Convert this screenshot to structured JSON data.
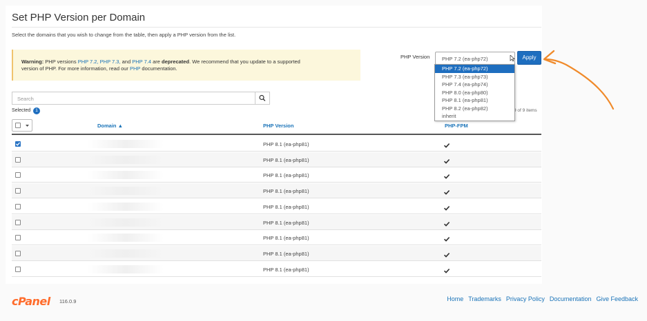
{
  "page": {
    "title": "Set PHP Version per Domain",
    "subtitle": "Select the domains that you wish to change from the table, then apply a PHP version from the list."
  },
  "warning": {
    "label": "Warning:",
    "text_1": " PHP versions ",
    "versions": "PHP 7.2, PHP 7.3,",
    "text_and": " and ",
    "version_last": "PHP 7.4",
    "text_are": " are ",
    "deprecated": "deprecated",
    "text_2": ". We recommend that you update to a supported",
    "text_3": "version of PHP. For more information, read our ",
    "link": "PHP",
    "text_4": " documentation."
  },
  "php_selector": {
    "label": "PHP Version",
    "selected": "PHP 7.2 (ea-php72)",
    "apply_label": "Apply",
    "options": [
      "PHP 7.2 (ea-php72)",
      "PHP 7.3 (ea-php73)",
      "PHP 7.4 (ea-php74)",
      "PHP 8.0 (ea-php80)",
      "PHP 8.1 (ea-php81)",
      "PHP 8.2 (ea-php82)",
      "inherit"
    ]
  },
  "search": {
    "placeholder": "Search"
  },
  "selection": {
    "label": "Selected",
    "count": "1",
    "items_count": "9 of 9 items"
  },
  "table": {
    "columns": {
      "domain": "Domain ▲",
      "php_version": "PHP Version",
      "php_fpm": "PHP-FPM"
    },
    "rows": [
      {
        "checked": true,
        "version": "PHP 8.1 (ea-php81)",
        "fpm": "✔"
      },
      {
        "checked": false,
        "version": "PHP 8.1 (ea-php81)",
        "fpm": "✔"
      },
      {
        "checked": false,
        "version": "PHP 8.1 (ea-php81)",
        "fpm": "✔"
      },
      {
        "checked": false,
        "version": "PHP 8.1 (ea-php81)",
        "fpm": "✔"
      },
      {
        "checked": false,
        "version": "PHP 8.1 (ea-php81)",
        "fpm": "✔"
      },
      {
        "checked": false,
        "version": "PHP 8.1 (ea-php81)",
        "fpm": "✔"
      },
      {
        "checked": false,
        "version": "PHP 8.1 (ea-php81)",
        "fpm": "✔"
      },
      {
        "checked": false,
        "version": "PHP 8.1 (ea-php81)",
        "fpm": "✔"
      },
      {
        "checked": false,
        "version": "PHP 8.1 (ea-php81)",
        "fpm": "✔"
      }
    ]
  },
  "footer": {
    "logo": "cPanel",
    "version": "116.0.9",
    "links": [
      "Home",
      "Trademarks",
      "Privacy Policy",
      "Documentation",
      "Give Feedback"
    ]
  },
  "colors": {
    "accent": "#1e6ebf",
    "brand": "#ff6c2c",
    "warning_bg": "#fcf7dc"
  },
  "icons": {
    "search": "search-icon",
    "check": "checkmark-icon",
    "arrow": "annotation-arrow-icon"
  }
}
